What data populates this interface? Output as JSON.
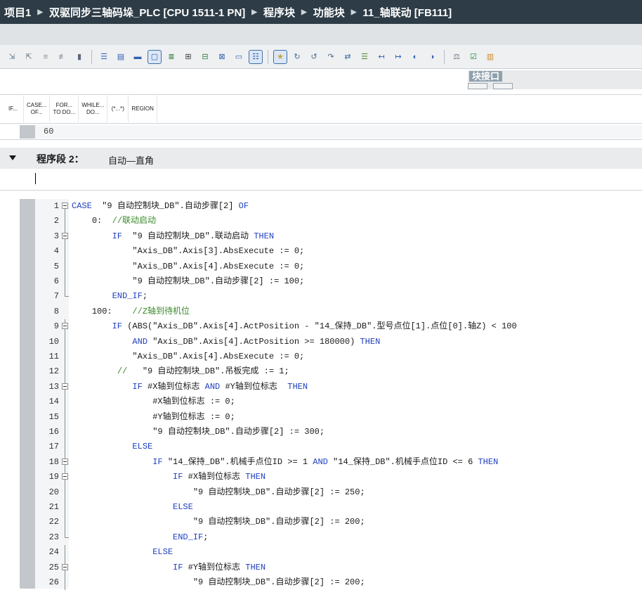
{
  "breadcrumb": [
    "项目1",
    "双驱同步三轴码垛_PLC [CPU 1511-1 PN]",
    "程序块",
    "功能块",
    "11_轴联动 [FB111]"
  ],
  "toolbar": {
    "icons": [
      "monitor-all-icon",
      "monitor-off-icon",
      "insert-row-icon",
      "delete-row-icon",
      "align-icon",
      "indent-icon",
      "outdent-icon",
      "comment-icon",
      "uncomment-icon",
      "toggle-comment-icon",
      "watch-icon",
      "bookmark-icon",
      "bookmark-next-icon",
      "bookmark-prev-icon",
      "list-icon",
      "favorites-icon",
      "breakpoint-icon",
      "step-icon",
      "step-over-icon",
      "call-env-icon",
      "monitor-icon",
      "nav-left-icon",
      "nav-right-icon",
      "load-icon",
      "unload-icon",
      "compare-icon",
      "check-icon",
      "db-icon"
    ]
  },
  "block_interface_label": "块接口",
  "instruction_palette": [
    "IF...",
    "CASE...\nOF...",
    "FOR...\nTO DO...",
    "WHILE...\nDO...",
    "(*...*)",
    "REGION"
  ],
  "previous_line_number": "60",
  "network": {
    "label": "程序段 2：",
    "comment": "自动—直角"
  },
  "code_lines": [
    {
      "n": "1",
      "fold": "box",
      "indent": "",
      "segs": [
        [
          "kw",
          "CASE"
        ],
        [
          "",
          "  \"9 自动控制块_DB\".自动步骤[2] "
        ],
        [
          "kw",
          "OF"
        ]
      ]
    },
    {
      "n": "2",
      "fold": "line",
      "indent": "    ",
      "segs": [
        [
          "",
          "0:  "
        ],
        [
          "cmt",
          "//联动启动"
        ]
      ]
    },
    {
      "n": "3",
      "fold": "box",
      "indent": "        ",
      "segs": [
        [
          "kw",
          "IF"
        ],
        [
          "",
          "  \"9 自动控制块_DB\".联动启动 "
        ],
        [
          "kw",
          "THEN"
        ]
      ]
    },
    {
      "n": "4",
      "fold": "line",
      "indent": "            ",
      "segs": [
        [
          "",
          "\"Axis_DB\".Axis[3].AbsExecute := 0;"
        ]
      ]
    },
    {
      "n": "5",
      "fold": "line",
      "indent": "            ",
      "segs": [
        [
          "",
          "\"Axis_DB\".Axis[4].AbsExecute := 0;"
        ]
      ]
    },
    {
      "n": "6",
      "fold": "line",
      "indent": "            ",
      "segs": [
        [
          "",
          "\"9 自动控制块_DB\".自动步骤[2] := 100;"
        ]
      ]
    },
    {
      "n": "7",
      "fold": "end",
      "indent": "        ",
      "segs": [
        [
          "kw",
          "END_IF"
        ],
        [
          "",
          ";"
        ]
      ]
    },
    {
      "n": "8",
      "fold": "none",
      "indent": "    ",
      "segs": [
        [
          "",
          "100:    "
        ],
        [
          "cmt",
          "//Z轴到待机位"
        ]
      ]
    },
    {
      "n": "9",
      "fold": "box",
      "indent": "        ",
      "segs": [
        [
          "kw",
          "IF"
        ],
        [
          "",
          " (ABS(\"Axis_DB\".Axis[4].ActPosition - \"14_保持_DB\".型号点位[1].点位[0].轴Z) < 100"
        ]
      ]
    },
    {
      "n": "10",
      "fold": "line",
      "indent": "            ",
      "segs": [
        [
          "kw",
          "AND"
        ],
        [
          "",
          " \"Axis_DB\".Axis[4].ActPosition >= 180000) "
        ],
        [
          "kw",
          "THEN"
        ]
      ]
    },
    {
      "n": "11",
      "fold": "line",
      "indent": "            ",
      "segs": [
        [
          "",
          "\"Axis_DB\".Axis[4].AbsExecute := 0;"
        ]
      ]
    },
    {
      "n": "12",
      "fold": "line",
      "indent": "         ",
      "segs": [
        [
          "cmt",
          "// "
        ],
        [
          "",
          "  \"9 自动控制块_DB\".吊板完成 := 1;"
        ]
      ]
    },
    {
      "n": "13",
      "fold": "box",
      "indent": "            ",
      "segs": [
        [
          "kw",
          "IF"
        ],
        [
          "",
          " #X轴到位标志 "
        ],
        [
          "kw",
          "AND"
        ],
        [
          "",
          " #Y轴到位标志  "
        ],
        [
          "kw",
          "THEN"
        ]
      ]
    },
    {
      "n": "14",
      "fold": "line",
      "indent": "                ",
      "segs": [
        [
          "",
          "#X轴到位标志 := 0;"
        ]
      ]
    },
    {
      "n": "15",
      "fold": "line",
      "indent": "                ",
      "segs": [
        [
          "",
          "#Y轴到位标志 := 0;"
        ]
      ]
    },
    {
      "n": "16",
      "fold": "line",
      "indent": "                ",
      "segs": [
        [
          "",
          "\"9 自动控制块_DB\".自动步骤[2] := 300;"
        ]
      ]
    },
    {
      "n": "17",
      "fold": "line",
      "indent": "            ",
      "segs": [
        [
          "kw",
          "ELSE"
        ]
      ]
    },
    {
      "n": "18",
      "fold": "box",
      "indent": "                ",
      "segs": [
        [
          "kw",
          "IF"
        ],
        [
          "",
          " \"14_保持_DB\".机械手点位ID >= 1 "
        ],
        [
          "kw",
          "AND"
        ],
        [
          "",
          " \"14_保持_DB\".机械手点位ID <= 6 "
        ],
        [
          "kw",
          "THEN"
        ]
      ]
    },
    {
      "n": "19",
      "fold": "box",
      "indent": "                    ",
      "segs": [
        [
          "kw",
          "IF"
        ],
        [
          "",
          " #X轴到位标志 "
        ],
        [
          "kw",
          "THEN"
        ]
      ]
    },
    {
      "n": "20",
      "fold": "line",
      "indent": "                        ",
      "segs": [
        [
          "",
          "\"9 自动控制块_DB\".自动步骤[2] := 250;"
        ]
      ]
    },
    {
      "n": "21",
      "fold": "line",
      "indent": "                    ",
      "segs": [
        [
          "kw",
          "ELSE"
        ]
      ]
    },
    {
      "n": "22",
      "fold": "line",
      "indent": "                        ",
      "segs": [
        [
          "",
          "\"9 自动控制块_DB\".自动步骤[2] := 200;"
        ]
      ]
    },
    {
      "n": "23",
      "fold": "end",
      "indent": "                    ",
      "segs": [
        [
          "kw",
          "END_IF"
        ],
        [
          "",
          ";"
        ]
      ]
    },
    {
      "n": "24",
      "fold": "line",
      "indent": "                ",
      "segs": [
        [
          "kw",
          "ELSE"
        ]
      ]
    },
    {
      "n": "25",
      "fold": "box",
      "indent": "                    ",
      "segs": [
        [
          "kw",
          "IF"
        ],
        [
          "",
          " #Y轴到位标志 "
        ],
        [
          "kw",
          "THEN"
        ]
      ]
    },
    {
      "n": "26",
      "fold": "line",
      "indent": "                        ",
      "segs": [
        [
          "",
          "\"9 自动控制块_DB\".自动步骤[2] := 200;"
        ]
      ]
    }
  ],
  "colors": {
    "keyword": "#1f3fbf",
    "comment": "#3a8a2a",
    "titlebar": "#2d3c46"
  }
}
